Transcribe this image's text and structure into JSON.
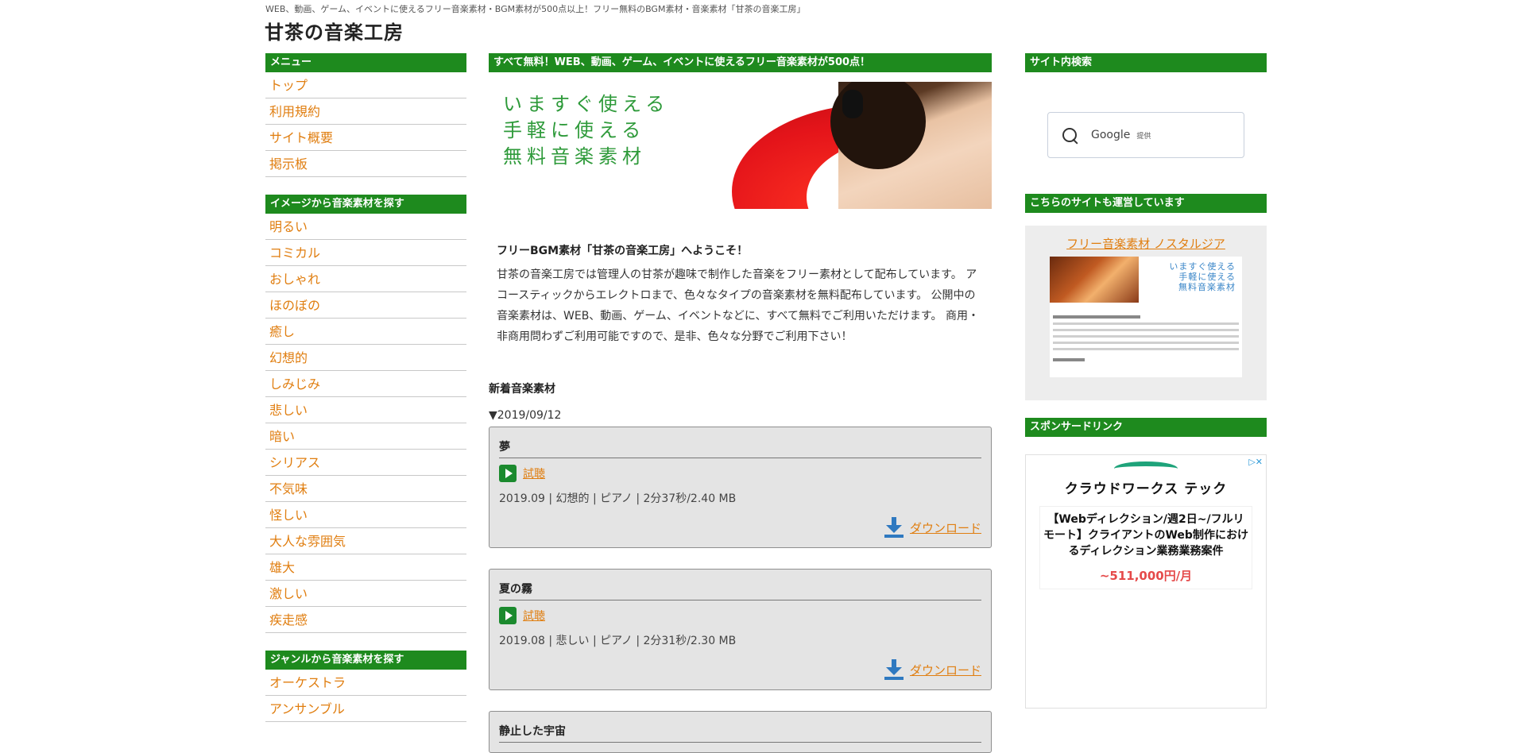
{
  "header": {
    "tagline": "WEB、動画、ゲーム、イベントに使えるフリー音楽素材・BGM素材が500点以上！フリー無料のBGM素材・音楽素材「甘茶の音楽工房」",
    "site_title": "甘茶の音楽工房"
  },
  "left": {
    "menu_heading": "メニュー",
    "menu_items": [
      "トップ",
      "利用規約",
      "サイト概要",
      "掲示板"
    ],
    "image_heading": "イメージから音楽素材を探す",
    "image_items": [
      "明るい",
      "コミカル",
      "おしゃれ",
      "ほのぼの",
      "癒し",
      "幻想的",
      "しみじみ",
      "悲しい",
      "暗い",
      "シリアス",
      "不気味",
      "怪しい",
      "大人な雰囲気",
      "雄大",
      "激しい",
      "疾走感"
    ],
    "genre_heading": "ジャンルから音楽素材を探す",
    "genre_items": [
      "オーケストラ",
      "アンサンブル"
    ]
  },
  "center": {
    "banner_heading": "すべて無料！WEB、動画、ゲーム、イベントに使えるフリー音楽素材が500点！",
    "hero_lines": [
      "いますぐ使える",
      "手軽に使える",
      "無料音楽素材"
    ],
    "welcome_title": "フリーBGM素材「甘茶の音楽工房」へようこそ！",
    "welcome_body": "甘茶の音楽工房では管理人の甘茶が趣味で制作した音楽をフリー素材として配布しています。 アコースティックからエレクトロまで、色々なタイプの音楽素材を無料配布しています。 公開中の音楽素材は、WEB、動画、ゲーム、イベントなどに、すべて無料でご利用いただけます。 商用・非商用問わずご利用可能ですので、是非、色々な分野でご利用下さい！",
    "new_title": "新着音楽素材",
    "date_label": "▼2019/09/12",
    "listen_label": "試聴",
    "download_label": "ダウンロード",
    "tracks": [
      {
        "title": "夢",
        "meta": "2019.09 | 幻想的 | ピアノ | 2分37秒/2.40 MB"
      },
      {
        "title": "夏の霧",
        "meta": "2019.08 | 悲しい | ピアノ | 2分31秒/2.30 MB"
      },
      {
        "title": "静止した宇宙",
        "meta": ""
      }
    ]
  },
  "right": {
    "search_heading": "サイト内検索",
    "search_google": "Google",
    "search_provided": "提供",
    "sister_heading": "こちらのサイトも運営しています",
    "sister_link": "フリー音楽素材 ノスタルジア",
    "sister_thumb_lines": [
      "いますぐ使える",
      "手軽に使える",
      "無料音楽素材"
    ],
    "sponsor_heading": "スポンサードリンク",
    "ad_logo": "クラウドワークス テック",
    "ad_text": "【Webディレクション/週2日~/フルリモート】クライアントのWeb制作におけるディレクション業務業務案件",
    "ad_price": "~511,000円/月"
  }
}
